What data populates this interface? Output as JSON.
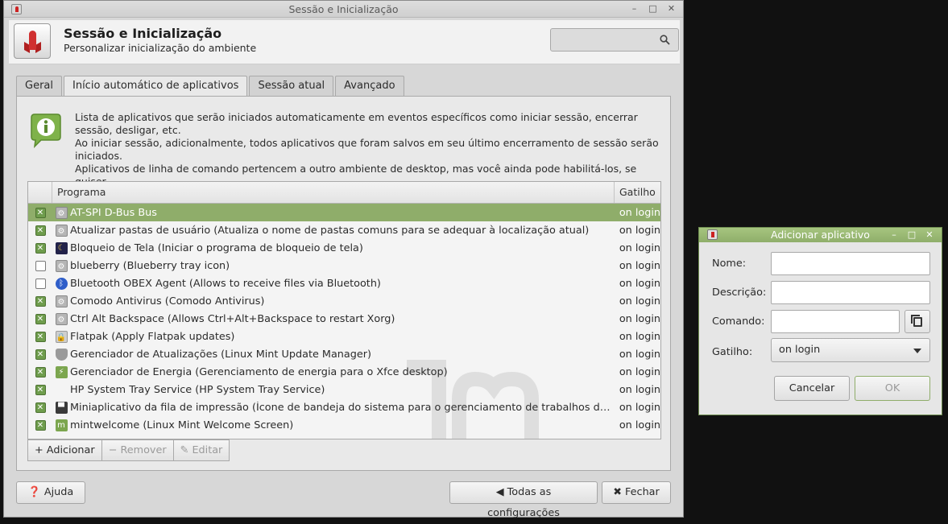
{
  "main_window": {
    "title": "Sessão e Inicialização",
    "header": {
      "title": "Sessão e Inicialização",
      "subtitle": "Personalizar inicialização do ambiente",
      "search_value": ""
    },
    "tabs": [
      {
        "label": "Geral",
        "active": false
      },
      {
        "label": "Início automático de aplicativos",
        "active": true
      },
      {
        "label": "Sessão atual",
        "active": false
      },
      {
        "label": "Avançado",
        "active": false
      }
    ],
    "info_lines": [
      "Lista de aplicativos que serão iniciados automaticamente em eventos específicos como iniciar sessão, encerrar sessão, desligar, etc.",
      "Ao iniciar sessão, adicionalmente, todos aplicativos que foram salvos em seu último encerramento de sessão serão iniciados.",
      "Aplicativos de linha de comando pertencem a outro ambiente de desktop, mas você ainda pode habilitá-los, se quiser."
    ],
    "table": {
      "col_program": "Programa",
      "col_trigger": "Gatilho",
      "rows": [
        {
          "checked": true,
          "icon": "gear-icon",
          "program": "AT-SPI D-Bus Bus",
          "trigger": "on login",
          "selected": true
        },
        {
          "checked": true,
          "icon": "gear-icon",
          "program": "Atualizar pastas de usuário (Atualiza o nome de pastas comuns para se adequar à localização atual)",
          "trigger": "on login",
          "selected": false
        },
        {
          "checked": true,
          "icon": "lock-icon",
          "program": "Bloqueio de Tela (Iniciar o programa de bloqueio de tela)",
          "trigger": "on login",
          "selected": false
        },
        {
          "checked": false,
          "icon": "gear-icon",
          "program": "blueberry (Blueberry tray icon)",
          "trigger": "on login",
          "selected": false
        },
        {
          "checked": false,
          "icon": "bluetooth-icon",
          "program": "Bluetooth OBEX Agent (Allows to receive files via Bluetooth)",
          "trigger": "on login",
          "selected": false
        },
        {
          "checked": true,
          "icon": "gear-icon",
          "program": "Comodo Antivirus (Comodo Antivirus)",
          "trigger": "on login",
          "selected": false
        },
        {
          "checked": true,
          "icon": "gear-icon",
          "program": "Ctrl Alt Backspace (Allows Ctrl+Alt+Backspace to restart Xorg)",
          "trigger": "on login",
          "selected": false
        },
        {
          "checked": true,
          "icon": "bag-icon",
          "program": "Flatpak (Apply Flatpak updates)",
          "trigger": "on login",
          "selected": false
        },
        {
          "checked": true,
          "icon": "shield-icon",
          "program": "Gerenciador de Atualizações (Linux Mint Update Manager)",
          "trigger": "on login",
          "selected": false
        },
        {
          "checked": true,
          "icon": "power-icon",
          "program": "Gerenciador de Energia (Gerenciamento de energia para o Xfce desktop)",
          "trigger": "on login",
          "selected": false
        },
        {
          "checked": true,
          "icon": "blank-icon",
          "program": "HP System Tray Service (HP System Tray Service)",
          "trigger": "on login",
          "selected": false
        },
        {
          "checked": true,
          "icon": "printer-icon",
          "program": "Miniaplicativo da fila de impressão (Ícone de bandeja do sistema para o gerenciamento de trabalhos de impressão)",
          "trigger": "on login",
          "selected": false
        },
        {
          "checked": true,
          "icon": "mint-icon",
          "program": "mintwelcome (Linux Mint Welcome Screen)",
          "trigger": "on login",
          "selected": false
        }
      ]
    },
    "toolbar": {
      "add": "Adicionar",
      "remove": "Remover",
      "edit": "Editar"
    },
    "footer": {
      "help": "Ajuda",
      "all_settings": "Todas as configurações",
      "close": "Fechar"
    }
  },
  "dialog": {
    "title": "Adicionar aplicativo",
    "name_label": "Nome:",
    "name_value": "",
    "description_label": "Descrição:",
    "description_value": "",
    "command_label": "Comando:",
    "command_value": "",
    "trigger_label": "Gatilho:",
    "trigger_value": "on login",
    "cancel": "Cancelar",
    "ok": "OK"
  },
  "colors": {
    "accent": "#8fad6a",
    "selection": "#8fad6a",
    "checkbox_on": "#6f9d4d",
    "desktop_bg": "#111111"
  }
}
